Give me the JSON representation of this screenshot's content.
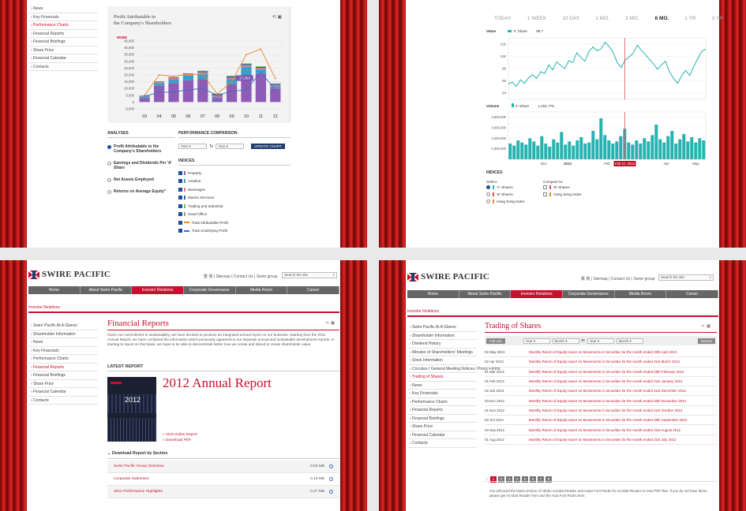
{
  "panel1": {
    "nav": [
      "News",
      "Key Financials",
      "Performance Charts",
      "Financial Reports",
      "Financial Briefings",
      "Share Price",
      "Financial Calendar",
      "Contacts"
    ],
    "nav_active": 2,
    "chart_title_1": "Profit Attributable to",
    "chart_title_2": "the Company's Shareholders",
    "unit": "HK$M",
    "callout": "17,363",
    "analyses_header": "ANALYSES",
    "analyses": [
      "Profit Attributable to the Company's Shareholders",
      "Earnings and Dividends Per 'A' Share",
      "Net Assets Employed",
      "Returns on Average Equity*"
    ],
    "perf_header": "PERFORMANCE COMPARISON",
    "year_placeholder": "Year",
    "to_label": "To",
    "update_btn": "UPDATE CHART",
    "indices_header": "INDICES",
    "indices": [
      "Property",
      "Aviation",
      "Beverages",
      "Marine Services",
      "Trading and Industrial",
      "Head Office",
      "Total Attributable Profit",
      "Total Underlying Profit"
    ],
    "index_colors": [
      "#8e5bb5",
      "#3aa0c9",
      "#e27b8c",
      "#2c5ea8",
      "#6fbf4b",
      "#999999",
      "#e8892b",
      "#3f6fc7"
    ]
  },
  "panel2": {
    "ranges": [
      "TODAY",
      "1 WEEK",
      "10 DAY",
      "1 MO.",
      "3 MO.",
      "6 MO.",
      "1 YR",
      "3 YR"
    ],
    "active_range": 5,
    "value_label": "Value",
    "series_label": "'A' Share",
    "series_value": "98.7",
    "volume_label": "Volume",
    "volume_value": "1,201,775",
    "x_labels": [
      "Dec",
      "2013",
      "Feb",
      "Apr",
      "May"
    ],
    "marker_label": "Feb 27, 2013",
    "indices_header": "INDICES",
    "select_label": "Select:",
    "compare_label": "Compare to:",
    "select_options": [
      "'A' Shares",
      "'B' Shares",
      "Hang Seng Index"
    ],
    "compare_options": [
      "'B' Shares",
      "Hang Seng Index"
    ]
  },
  "panel3": {
    "logo": "SWIRE PACIFIC",
    "top_links": "繁 简 | Sitemap | Contact Us | Swire group",
    "search_placeholder": "Search the site",
    "menu": [
      "Home",
      "About Swire Pacific",
      "Investor Relations",
      "Corporate Governance",
      "Media Room",
      "Career"
    ],
    "menu_active": 2,
    "section": "Investor Relations",
    "nav": [
      "Swire Pacific At A Glance",
      "Shareholder Information",
      "News",
      "Key Financials",
      "Performance Charts",
      "Financial Reports",
      "Financial Briefings",
      "Share Price",
      "Financial Calendar",
      "Contacts"
    ],
    "nav_active": 5,
    "title": "Financial Reports",
    "intro": "Given our commitment to sustainability, we have decided to produce an integrated annual report on our business. Starting from the 2011 Annual Report, we have combined the information which previously appeared in our separate annual and sustainable development reports. In starting to report on this basis, we hope to be able to demonstrate better how we create and intend to create shareholder value.",
    "latest_header": "LATEST REPORT",
    "report_title": "2012 Annual Report",
    "cover_year": "2012",
    "link_online": "» Visit Online Report",
    "link_pdf": "» Download PDF",
    "download_header": "Download Report by Section",
    "downloads": [
      {
        "name": "Swire Pacific Group Overview",
        "size": "0.53 MB"
      },
      {
        "name": "Corporate Statement",
        "size": "0.19 MB"
      },
      {
        "name": "2012 Performance Highlights",
        "size": "0.27 MB"
      }
    ]
  },
  "panel4": {
    "logo": "SWIRE PACIFIC",
    "top_links": "繁 简 | Sitemap | Contact Us | Swire group",
    "search_placeholder": "Search the site",
    "menu": [
      "Home",
      "About Swire Pacific",
      "Investor Relations",
      "Corporate Governance",
      "Media Room",
      "Career"
    ],
    "menu_active": 2,
    "section": "Investor Relations",
    "nav": [
      "Swire Pacific At A Glance",
      "Shareholder Information",
      "Dividend History",
      "Minutes of Shareholders' Meetings",
      "Stock Information",
      "Circulars / General Meeting Notices / Proxy Forms",
      "Trading of Shares",
      "News",
      "Key Financials",
      "Performance Charts",
      "Financial Reports",
      "Financial Briefings",
      "Share Price",
      "Financial Calendar",
      "Contacts"
    ],
    "nav_active": 6,
    "title": "Trading of Shares",
    "full_list": "Full List",
    "year_ph": "Year",
    "month_ph": "Month",
    "to_label": "to",
    "search_btn": "Search",
    "rows": [
      {
        "date": "02 May 2013",
        "title": "Monthly Return of Equity Issuer on Movements in Securities for the month ended 30th April 2013"
      },
      {
        "date": "02 Apr 2013",
        "title": "Monthly Return of Equity Issuer on Movements in Securities for the month ended 31st March 2013"
      },
      {
        "date": "01 Mar 2013",
        "title": "Monthly Return of Equity Issuer on Movements in Securities for the month ended 28th February 2013"
      },
      {
        "date": "01 Feb 2013",
        "title": "Monthly Return of Equity Issuer on Movements in Securities for the month ended 31st January 2013"
      },
      {
        "date": "02 Jan 2013",
        "title": "Monthly Return of Equity Issuer on Movements in Securities for the month ended 31st December 2012"
      },
      {
        "date": "03 Dec 2012",
        "title": "Monthly Return of Equity Issuer on Movements in Securities for the month ended 30th November 2012"
      },
      {
        "date": "01 Nov 2012",
        "title": "Monthly Return of Equity Issuer on Movements in Securities for the month ended 31st October 2012"
      },
      {
        "date": "02 Oct 2012",
        "title": "Monthly Return of Equity Issuer on Movements in Securities for the month ended 30th September 2012"
      },
      {
        "date": "03 Sep 2012",
        "title": "Monthly Return of Equity Issuer on Movements in Securities for the month ended 31st August 2012"
      },
      {
        "date": "01 Aug 2012",
        "title": "Monthly Return of Equity Issuer on Movements in Securities for the month ended 31st July 2012"
      }
    ],
    "pages": [
      "1",
      "2",
      "3",
      "4",
      "5",
      "6",
      "7",
      "8"
    ],
    "page_active": 0,
    "footer_note": "You will need the latest version of Adobe Acrobat Reader and Asian Font Packs for Acrobat Reader to view PDF files. If you do not have these, please get Acrobat Reader here and the Asia Font Packs here."
  },
  "chart_data": [
    {
      "type": "bar",
      "title": "Profit Attributable to the Company's Shareholders",
      "ylabel": "HK$M",
      "categories": [
        "03",
        "04",
        "05",
        "06",
        "07",
        "08",
        "09",
        "10",
        "11",
        "12"
      ],
      "series": [
        {
          "name": "Property",
          "values": [
            3000,
            12000,
            14000,
            16000,
            17000,
            3000,
            13000,
            20000,
            21000,
            10000
          ]
        },
        {
          "name": "Aviation",
          "values": [
            1000,
            2000,
            3000,
            3500,
            4000,
            1000,
            4000,
            6000,
            3000,
            1500
          ]
        },
        {
          "name": "Beverages",
          "values": [
            500,
            700,
            800,
            900,
            1000,
            900,
            1000,
            1200,
            1100,
            1000
          ]
        },
        {
          "name": "Marine Services",
          "values": [
            200,
            300,
            400,
            500,
            800,
            1000,
            900,
            800,
            800,
            700
          ]
        },
        {
          "name": "Trading and Industrial",
          "values": [
            200,
            300,
            300,
            300,
            300,
            400,
            500,
            500,
            500,
            600
          ]
        }
      ],
      "lines": [
        {
          "name": "Total Attributable Profit",
          "values": [
            5000,
            20000,
            19000,
            20500,
            20500,
            6000,
            15000,
            35000,
            39000,
            17363
          ]
        },
        {
          "name": "Total Underlying Profit",
          "values": [
            4500,
            7000,
            7500,
            9000,
            10000,
            5000,
            8000,
            9000,
            22000,
            9000
          ]
        }
      ],
      "yticks": [
        -5000,
        0,
        5000,
        10000,
        15000,
        20000,
        25000,
        30000,
        35000,
        40000,
        45000
      ],
      "ylim": [
        -5000,
        45000
      ]
    },
    {
      "type": "line",
      "series_name": "'A' Share",
      "yticks": [
        94,
        96,
        98,
        100,
        102
      ],
      "ylim": [
        93,
        103
      ],
      "values": [
        95.5,
        95.8,
        95.1,
        96.2,
        95.6,
        96.5,
        97.0,
        96.4,
        97.5,
        97.2,
        98.6,
        97.8,
        99.1,
        98.5,
        98.0,
        99.3,
        99.0,
        100.6,
        99.8,
        99.2,
        100.8,
        101.5,
        100.9,
        101.2,
        102.3,
        101.6,
        100.7,
        99.0,
        98.2,
        99.4,
        99.9,
        100.5,
        101.8,
        101.0,
        100.3,
        99.5,
        98.8,
        97.9,
        98.6,
        99.2,
        97.5,
        96.4,
        95.6,
        96.8,
        97.7,
        96.9,
        98.3,
        99.6,
        100.8,
        101.2
      ]
    },
    {
      "type": "bar",
      "series_name": "'A' Share Volume",
      "yticks": [
        1000000,
        2000000,
        3000000,
        4000000
      ],
      "ylim": [
        0,
        4500000
      ],
      "values": [
        1500000,
        1300000,
        1800000,
        1600000,
        1400000,
        2000000,
        1700000,
        1300000,
        2200000,
        1500000,
        1200000,
        1900000,
        1600000,
        2600000,
        1400000,
        1700000,
        1300000,
        1800000,
        2100000,
        1500000,
        1600000,
        2700000,
        1900000,
        3900000,
        2300000,
        1800000,
        1500000,
        1700000,
        2200000,
        2900000,
        1600000,
        1400000,
        1800000,
        1500000,
        2000000,
        1700000,
        2300000,
        3300000,
        1900000,
        1600000,
        2200000,
        2700000,
        1500000,
        1900000,
        2400000,
        1700000,
        2100000,
        1600000,
        2000000,
        1800000
      ]
    }
  ]
}
